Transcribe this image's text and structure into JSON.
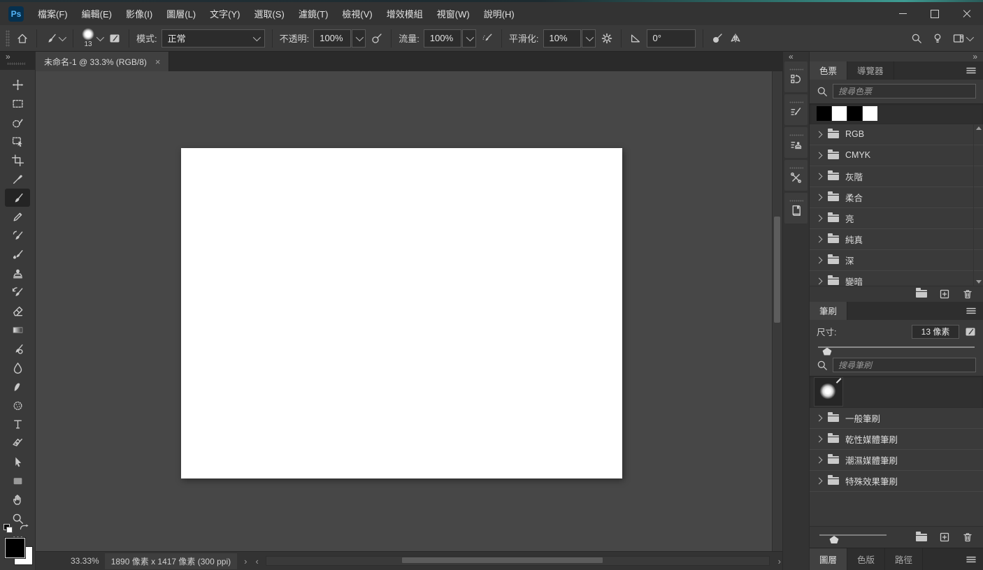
{
  "menu_bar": {
    "logo_text": "Ps",
    "items": [
      "檔案(F)",
      "編輯(E)",
      "影像(I)",
      "圖層(L)",
      "文字(Y)",
      "選取(S)",
      "濾鏡(T)",
      "檢視(V)",
      "增效模組",
      "視窗(W)",
      "說明(H)"
    ]
  },
  "options_bar": {
    "brush_size_badge": "13",
    "mode": {
      "label": "模式:",
      "value": "正常"
    },
    "opacity": {
      "label": "不透明:",
      "value": "100%"
    },
    "flow": {
      "label": "流量:",
      "value": "100%"
    },
    "smoothing": {
      "label": "平滑化:",
      "value": "10%"
    },
    "angle": {
      "value": "0°"
    }
  },
  "document_tab": {
    "title": "未命名-1 @ 33.3% (RGB/8)",
    "close_glyph": "×"
  },
  "tools": [
    {
      "id": "move-tool",
      "icon": "move"
    },
    {
      "id": "rectangular-marquee-tool",
      "icon": "marquee"
    },
    {
      "id": "selection-brush-tool",
      "icon": "selection-brush"
    },
    {
      "id": "object-selection-tool",
      "icon": "object-selection"
    },
    {
      "id": "crop-tool",
      "icon": "crop"
    },
    {
      "id": "eyedropper-tool",
      "icon": "eyedropper"
    },
    {
      "id": "brush-tool",
      "icon": "brush",
      "selected": true
    },
    {
      "id": "pencil-tool",
      "icon": "pencil"
    },
    {
      "id": "color-replacement-tool",
      "icon": "color-replacement"
    },
    {
      "id": "mixer-brush-tool",
      "icon": "mixer-brush"
    },
    {
      "id": "clone-stamp-tool",
      "icon": "clone-stamp"
    },
    {
      "id": "history-brush-tool",
      "icon": "history-brush"
    },
    {
      "id": "eraser-tool",
      "icon": "eraser"
    },
    {
      "id": "gradient-tool",
      "icon": "gradient"
    },
    {
      "id": "remove-tool",
      "icon": "remove"
    },
    {
      "id": "blur-tool",
      "icon": "blur"
    },
    {
      "id": "smudge-tool",
      "icon": "smudge"
    },
    {
      "id": "sponge-tool",
      "icon": "sponge"
    },
    {
      "id": "type-tool",
      "icon": "type"
    },
    {
      "id": "pen-tool",
      "icon": "pen"
    },
    {
      "id": "path-selection-tool",
      "icon": "path-selection"
    },
    {
      "id": "rectangle-tool",
      "icon": "rectangle"
    },
    {
      "id": "hand-tool",
      "icon": "hand"
    },
    {
      "id": "zoom-tool",
      "icon": "zoom"
    },
    {
      "id": "edit-toolbar-button",
      "icon": "ellipsis"
    }
  ],
  "status_bar": {
    "zoom_level": "33.33%",
    "doc_info": "1890 像素 x 1417 像素 (300 ppi)",
    "nav_next": "›",
    "nav_prev": "‹"
  },
  "right_dock": {
    "tools_collapse": "»",
    "collapse_left": "«",
    "collapse_right": "»",
    "collapsed_panels": [
      {
        "id": "history-panel-button",
        "icon": "history-panel"
      },
      {
        "id": "brush-settings-panel-button",
        "icon": "brush-settings-panel"
      },
      {
        "id": "clone-source-panel-button",
        "icon": "clone-source-panel"
      },
      {
        "id": "tool-presets-panel-button",
        "icon": "tool-presets-panel"
      },
      {
        "id": "libraries-panel-button",
        "icon": "libraries-panel"
      }
    ],
    "swatches_panel": {
      "tabs": [
        {
          "label": "色票",
          "active": true
        },
        {
          "label": "導覽器",
          "active": false
        }
      ],
      "search_placeholder": "搜尋色票",
      "recent_swatches": [
        "#000000",
        "#ffffff",
        "#000000",
        "#ffffff"
      ],
      "groups": [
        "RGB",
        "CMYK",
        "灰階",
        "柔合",
        "亮",
        "純真",
        "深",
        "變暗"
      ]
    },
    "brushes_panel": {
      "tabs": [
        {
          "label": "筆刷",
          "active": true
        }
      ],
      "size_label": "尺寸:",
      "size_value": "13 像素",
      "search_placeholder": "搜尋筆刷",
      "groups": [
        "一般筆刷",
        "乾性媒體筆刷",
        "潮濕媒體筆刷",
        "特殊效果筆刷"
      ]
    },
    "bottom_tabs": [
      {
        "label": "圖層",
        "active": true
      },
      {
        "label": "色版",
        "active": false
      },
      {
        "label": "路徑",
        "active": false
      }
    ]
  },
  "colors": {
    "foreground": "#000000",
    "background": "#ffffff",
    "ui_dark": "#333333",
    "canvas_board": "#474747",
    "doc_white": "#ffffff",
    "logo_blue": "#54b4f6"
  }
}
